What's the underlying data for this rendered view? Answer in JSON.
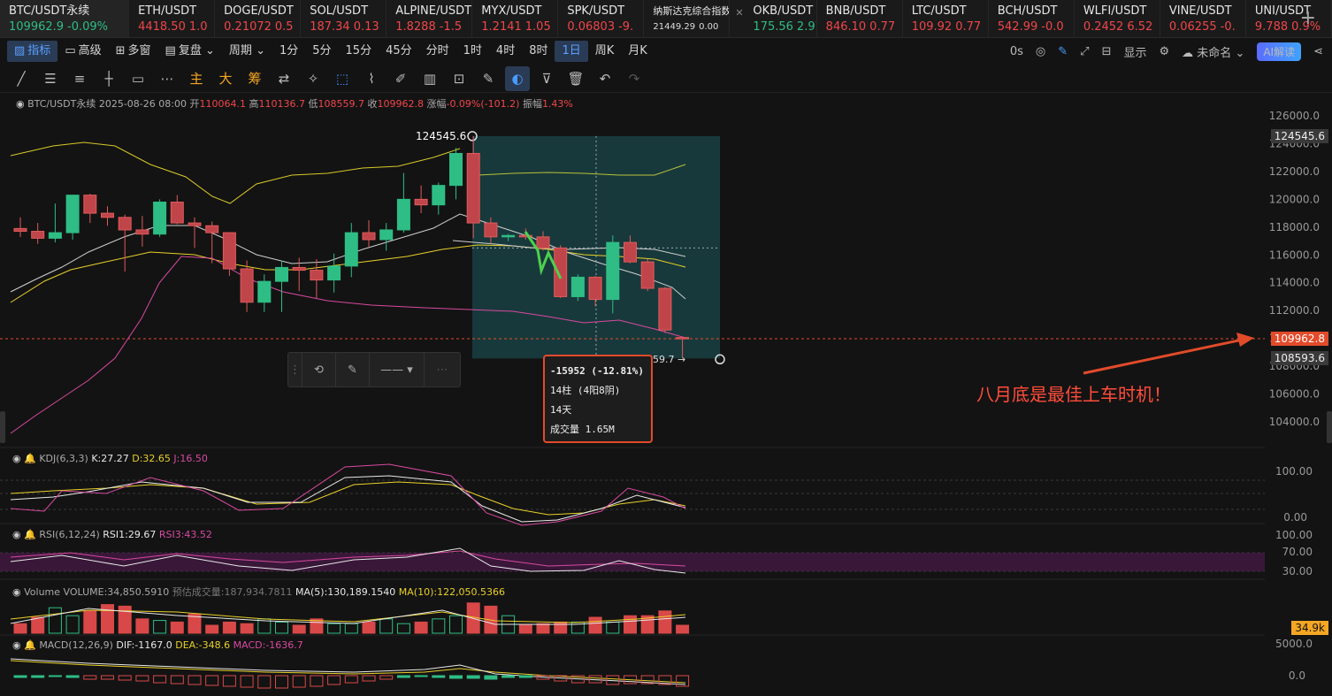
{
  "tickers": [
    {
      "symbol": "BTC/USDT永续",
      "price": "109962.9",
      "change": "-0.09%",
      "dir": "up",
      "active": true
    },
    {
      "symbol": "ETH/USDT",
      "price": "4418.50",
      "change": "1.0",
      "dir": "down"
    },
    {
      "symbol": "DOGE/USDT",
      "price": "0.21072",
      "change": "0.5",
      "dir": "down"
    },
    {
      "symbol": "SOL/USDT",
      "price": "187.34",
      "change": "0.13",
      "dir": "down"
    },
    {
      "symbol": "ALPINE/USDT",
      "price": "1.8288",
      "change": "-1.5",
      "dir": "down"
    },
    {
      "symbol": "MYX/USDT",
      "price": "1.2141",
      "change": "1.05",
      "dir": "down"
    },
    {
      "symbol": "SPK/USDT",
      "price": "0.06803",
      "change": "-9.",
      "dir": "down"
    },
    {
      "symbol": "纳斯达克综合指数",
      "price": "21449.29",
      "change": "0.00",
      "dir": "flat",
      "small": true
    },
    {
      "symbol": "OKB/USDT",
      "price": "175.56",
      "change": "2.97",
      "dir": "up",
      "closable": true
    },
    {
      "symbol": "BNB/USDT",
      "price": "846.10",
      "change": "0.77",
      "dir": "down"
    },
    {
      "symbol": "LTC/USDT",
      "price": "109.92",
      "change": "0.77",
      "dir": "down"
    },
    {
      "symbol": "BCH/USDT",
      "price": "542.99",
      "change": "-0.0",
      "dir": "down"
    },
    {
      "symbol": "WLFI/USDT",
      "price": "0.2452",
      "change": "6.52",
      "dir": "down"
    },
    {
      "symbol": "VINE/USDT",
      "price": "0.06255",
      "change": "-0.",
      "dir": "down"
    },
    {
      "symbol": "UNI/USDT",
      "price": "9.788",
      "change": "0.9%",
      "dir": "down"
    }
  ],
  "toolbar": {
    "indicators": "指标",
    "advanced": "高级",
    "multi_window": "多窗",
    "replay": "复盘",
    "period": "周期",
    "intervals": [
      "1分",
      "5分",
      "15分",
      "45分",
      "分时",
      "1时",
      "4时",
      "8时",
      "1日",
      "周K",
      "月K"
    ],
    "selected_interval": "1日",
    "right": {
      "timer": "0s",
      "display": "显示",
      "unnamed": "未命名",
      "ai": "AI解读"
    }
  },
  "drawbar": {
    "main": "主",
    "big": "大",
    "chip": "筹"
  },
  "ohlc": {
    "symbol": "BTC/USDT永续",
    "date": "2025-08-26 08:00",
    "open_label": "开",
    "open": "110064.1",
    "high_label": "高",
    "high": "110136.7",
    "low_label": "低",
    "low": "108559.7",
    "close_label": "收",
    "close": "109962.8",
    "change_label": "涨幅",
    "change": "-0.09%(-101.2)",
    "amp_label": "振幅",
    "amp": "1.43%"
  },
  "price_axis": {
    "ticks": [
      "126000.0",
      "124000.0",
      "122000.0",
      "120000.0",
      "118000.0",
      "116000.0",
      "114000.0",
      "112000.0",
      "110000.0",
      "108000.0",
      "106000.0",
      "104000.0"
    ],
    "high_tag": "124545.6",
    "current_tag": "109962.8",
    "low_tag": "108593.6"
  },
  "chart_labels": {
    "high_marker": "124545.6",
    "low_marker": "108559.7 →"
  },
  "measure": {
    "line1": "-15952 (-12.81%)",
    "line2": "14柱 (4阳8阴)",
    "line3": "14天",
    "line4": "成交量 1.65M"
  },
  "annotation": "八月底是最佳上车时机！",
  "kdj": {
    "name": "KDJ(6,3,3)",
    "k": "K:27.27",
    "d": "D:32.65",
    "j": "J:16.50",
    "ticks": [
      "100.00",
      "0.00"
    ]
  },
  "rsi": {
    "name": "RSI(6,12,24)",
    "rsi1": "RSI1:29.67",
    "rsi3": "RSI3:43.52",
    "ticks": [
      "100.00",
      "70.00",
      "30.00"
    ]
  },
  "volume": {
    "name": "Volume",
    "vol": "VOLUME:34,850.5910",
    "est": "预估成交量:187,934.7811",
    "ma5": "MA(5):130,189.1540",
    "ma10": "MA(10):122,050.5366",
    "tag": "34.9k"
  },
  "macd": {
    "name": "MACD(12,26,9)",
    "dif": "DIF:-1167.0",
    "dea": "DEA:-348.6",
    "macd": "MACD:-1636.7",
    "ticks": [
      "5000.0",
      "0.0"
    ]
  },
  "candles": [
    {
      "o": 117900,
      "h": 118700,
      "l": 117300,
      "c": 117700
    },
    {
      "o": 117700,
      "h": 118300,
      "l": 116800,
      "c": 117200
    },
    {
      "o": 117200,
      "h": 119700,
      "l": 116900,
      "c": 117600
    },
    {
      "o": 117600,
      "h": 120300,
      "l": 117100,
      "c": 120300
    },
    {
      "o": 120300,
      "h": 120400,
      "l": 118300,
      "c": 119000
    },
    {
      "o": 119000,
      "h": 119500,
      "l": 118100,
      "c": 118700
    },
    {
      "o": 118700,
      "h": 118900,
      "l": 114800,
      "c": 117800
    },
    {
      "o": 117800,
      "h": 118800,
      "l": 116600,
      "c": 117500
    },
    {
      "o": 117500,
      "h": 120000,
      "l": 117300,
      "c": 119800
    },
    {
      "o": 119800,
      "h": 120300,
      "l": 118200,
      "c": 118300
    },
    {
      "o": 118300,
      "h": 118700,
      "l": 116500,
      "c": 118100
    },
    {
      "o": 118100,
      "h": 118400,
      "l": 115400,
      "c": 117600
    },
    {
      "o": 117600,
      "h": 117600,
      "l": 114500,
      "c": 115000
    },
    {
      "o": 115000,
      "h": 115600,
      "l": 111900,
      "c": 112600
    },
    {
      "o": 112600,
      "h": 114600,
      "l": 111900,
      "c": 114100
    },
    {
      "o": 114100,
      "h": 115600,
      "l": 111900,
      "c": 115100
    },
    {
      "o": 115100,
      "h": 115800,
      "l": 113400,
      "c": 114900
    },
    {
      "o": 114900,
      "h": 115700,
      "l": 112900,
      "c": 114200
    },
    {
      "o": 114200,
      "h": 116100,
      "l": 113300,
      "c": 115200
    },
    {
      "o": 115200,
      "h": 118300,
      "l": 114400,
      "c": 117600
    },
    {
      "o": 117600,
      "h": 118500,
      "l": 116600,
      "c": 117100
    },
    {
      "o": 117100,
      "h": 118300,
      "l": 116300,
      "c": 117800
    },
    {
      "o": 117800,
      "h": 121900,
      "l": 117600,
      "c": 120000
    },
    {
      "o": 120000,
      "h": 121000,
      "l": 119000,
      "c": 119600
    },
    {
      "o": 119600,
      "h": 121200,
      "l": 118900,
      "c": 121000
    },
    {
      "o": 121000,
      "h": 123700,
      "l": 120000,
      "c": 123300
    },
    {
      "o": 123300,
      "h": 124545,
      "l": 117200,
      "c": 118300
    },
    {
      "o": 118300,
      "h": 118700,
      "l": 116800,
      "c": 117300
    },
    {
      "o": 117300,
      "h": 117500,
      "l": 117000,
      "c": 117400
    },
    {
      "o": 117400,
      "h": 117900,
      "l": 117100,
      "c": 117300
    },
    {
      "o": 117300,
      "h": 117700,
      "l": 116300,
      "c": 116500
    },
    {
      "o": 116500,
      "h": 116700,
      "l": 112900,
      "c": 113000
    },
    {
      "o": 113000,
      "h": 114600,
      "l": 112700,
      "c": 114400
    },
    {
      "o": 114400,
      "h": 114500,
      "l": 112300,
      "c": 112800
    },
    {
      "o": 112800,
      "h": 117400,
      "l": 111800,
      "c": 116900
    },
    {
      "o": 116900,
      "h": 117400,
      "l": 115400,
      "c": 115500
    },
    {
      "o": 115500,
      "h": 115700,
      "l": 113400,
      "c": 113600
    },
    {
      "o": 113600,
      "h": 113700,
      "l": 110400,
      "c": 110600
    },
    {
      "o": 110064,
      "h": 110137,
      "l": 108560,
      "c": 109963
    }
  ]
}
